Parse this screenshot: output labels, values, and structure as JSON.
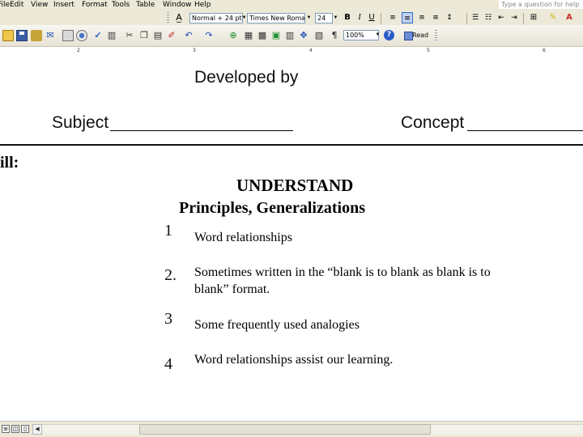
{
  "menu": {
    "items": [
      "File",
      "Edit",
      "View",
      "Insert",
      "Format",
      "Tools",
      "Table",
      "Window",
      "Help"
    ]
  },
  "formatting": {
    "style": "Normal + 24 pt",
    "font": "Times New Roman",
    "size": "24",
    "ask_placeholder": "Type a question for help"
  },
  "standard": {
    "zoom": "100%",
    "read_label": "Read"
  },
  "ruler": {
    "numbers": [
      "2",
      "3",
      "4",
      "5",
      "6"
    ]
  },
  "document": {
    "developed_by": "Developed by",
    "subject_label": "Subject",
    "concept_label": "Concept",
    "skill_label": "ill:",
    "heading1": "UNDERSTAND",
    "heading2": "Principles, Generalizations",
    "items": [
      {
        "num": "1",
        "text": "Word relationships"
      },
      {
        "num": "2.",
        "text": "Sometimes written in the “blank is to blank as blank is to blank” format."
      },
      {
        "num": "3",
        "text": "Some frequently used analogies"
      },
      {
        "num": "4",
        "text": "Word relationships assist our learning."
      }
    ]
  }
}
